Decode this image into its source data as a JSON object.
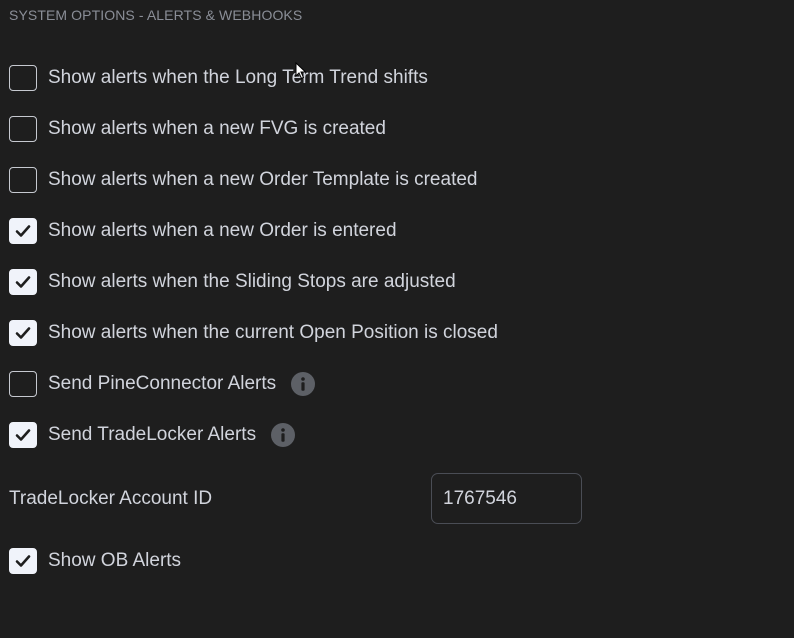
{
  "section_title": "SYSTEM OPTIONS - ALERTS & WEBHOOKS",
  "options": [
    {
      "label": "Show alerts when the Long Term Trend shifts",
      "checked": false
    },
    {
      "label": "Show alerts when a new FVG is created",
      "checked": false
    },
    {
      "label": "Show alerts when a new Order Template is created",
      "checked": false
    },
    {
      "label": "Show alerts when a new Order is entered",
      "checked": true
    },
    {
      "label": "Show alerts when the Sliding Stops are adjusted",
      "checked": true
    },
    {
      "label": "Show alerts when the current Open Position is closed",
      "checked": true
    },
    {
      "label": "Send PineConnector Alerts",
      "checked": false,
      "icon": "info-icon"
    },
    {
      "label": "Send TradeLocker Alerts",
      "checked": true,
      "icon": "info-icon"
    }
  ],
  "account_field": {
    "label": "TradeLocker Account ID",
    "value": "1767546"
  },
  "ob_option": {
    "label": "Show OB Alerts",
    "checked": true
  },
  "colors": {
    "background": "#1e1e1e",
    "text": "#d1d4dc",
    "muted_text": "#8a8e97",
    "checkbox_checked_fill": "#f0f3fa",
    "info_icon_fill": "#5d6066"
  }
}
